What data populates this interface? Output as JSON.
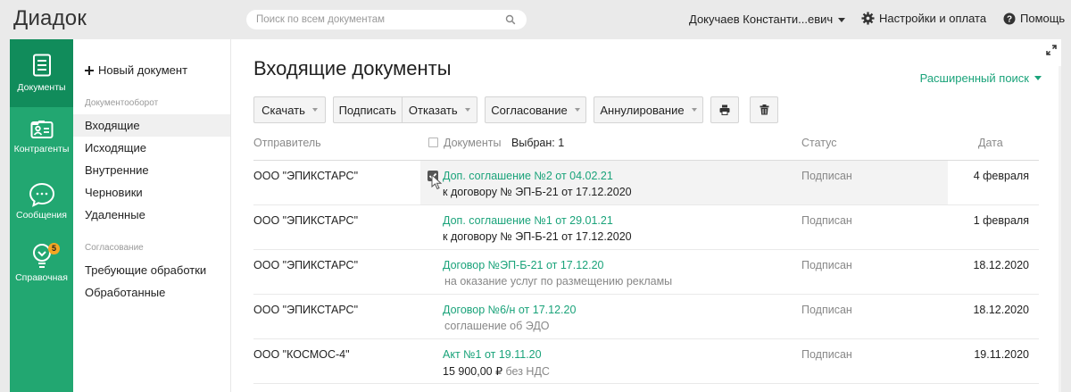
{
  "app": {
    "logo": "Диадок"
  },
  "search": {
    "placeholder": "Поиск по всем документам"
  },
  "header": {
    "user_name": "Докучаев Константи...евич",
    "settings_label": "Настройки и оплата",
    "help_label": "Помощь"
  },
  "rail": {
    "items": [
      {
        "label": "Документы",
        "icon": "document-icon",
        "active": true
      },
      {
        "label": "Контрагенты",
        "icon": "contact-card-icon"
      },
      {
        "label": "Сообщения",
        "icon": "chat-bubble-icon"
      },
      {
        "label": "Справочная",
        "icon": "lightbulb-icon",
        "badge": "5"
      }
    ]
  },
  "nav": {
    "new_document": "Новый документ",
    "section_docflow": "Документооборот",
    "docflow_items": [
      "Входящие",
      "Исходящие",
      "Внутренние",
      "Черновики",
      "Удаленные"
    ],
    "section_approval": "Согласование",
    "approval_items": [
      "Требующие обработки",
      "Обработанные"
    ]
  },
  "main": {
    "title": "Входящие документы",
    "advanced_search": "Расширенный поиск",
    "toolbar": {
      "download": "Скачать",
      "sign": "Подписать",
      "reject": "Отказать",
      "approval": "Согласование",
      "annul": "Аннулирование"
    },
    "table": {
      "col_sender": "Отправитель",
      "col_documents": "Документы",
      "selected": "Выбран: 1",
      "col_status": "Статус",
      "col_date": "Дата",
      "rows": [
        {
          "sender": "ООО \"ЭПИКСТАРС\"",
          "doc": "Доп. соглашение №2 от 04.02.21",
          "sub": "к договору № ЭП-Б-21 от 17.12.2020",
          "status": "Подписан",
          "date": "4 февраля"
        },
        {
          "sender": "ООО \"ЭПИКСТАРС\"",
          "doc": "Доп. соглашение №1 от 29.01.21",
          "sub": "к договору № ЭП-Б-21 от 17.12.2020",
          "status": "Подписан",
          "date": "1 февраля"
        },
        {
          "sender": "ООО \"ЭПИКСТАРС\"",
          "doc": "Договор №ЭП-Б-21 от 17.12.20",
          "sub": "на оказание услуг по размещению рекламы",
          "status": "Подписан",
          "date": "18.12.2020"
        },
        {
          "sender": "ООО \"ЭПИКСТАРС\"",
          "doc": "Договор №6/н от 17.12.20",
          "sub": "соглашение об ЭДО",
          "status": "Подписан",
          "date": "18.12.2020"
        },
        {
          "sender": "ООО \"КОСМОС-4\"",
          "doc": "Акт №1 от 19.11.20",
          "sub_amount": "15 900,00 ₽",
          "sub_vat": "без НДС",
          "status": "Подписан",
          "date": "19.11.2020"
        }
      ]
    }
  },
  "colors": {
    "brand_green": "#22a771",
    "active_green": "#118c5b",
    "link_green": "#1aa37a",
    "badge_orange": "#f5a623"
  }
}
